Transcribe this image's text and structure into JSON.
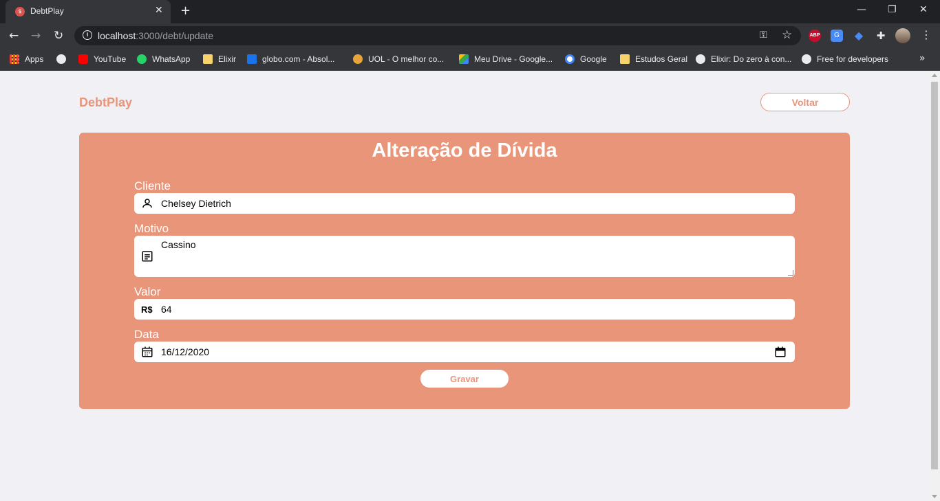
{
  "browser": {
    "tab_title": "DebtPlay",
    "url_host": "localhost",
    "url_rest": ":3000/debt/update",
    "bookmarks": [
      {
        "label": "Apps",
        "icon": "apps-grid-icon",
        "color": "#ea4335"
      },
      {
        "label": "",
        "icon": "globe-icon",
        "color": "#e8eaed"
      },
      {
        "label": "YouTube",
        "icon": "youtube-icon",
        "color": "#ff0000"
      },
      {
        "label": "WhatsApp",
        "icon": "whatsapp-icon",
        "color": "#25d366"
      },
      {
        "label": "Elixir",
        "icon": "folder-icon",
        "color": "#f6d36b"
      },
      {
        "label": "globo.com - Absol...",
        "icon": "globo-icon",
        "color": "#1a73e8"
      },
      {
        "label": "UOL - O melhor co...",
        "icon": "uol-icon",
        "color": "#e8a33a"
      },
      {
        "label": "Meu Drive - Google...",
        "icon": "drive-icon",
        "color": "#34a853"
      },
      {
        "label": "Google",
        "icon": "google-icon",
        "color": "#4285f4"
      },
      {
        "label": "Estudos Geral",
        "icon": "folder-icon",
        "color": "#f6d36b"
      },
      {
        "label": "Elixir: Do zero à con...",
        "icon": "globe-icon",
        "color": "#e8eaed"
      },
      {
        "label": "Free for developers",
        "icon": "globe-icon",
        "color": "#e8eaed"
      }
    ]
  },
  "header": {
    "brand": "DebtPlay",
    "back_label": "Voltar"
  },
  "form": {
    "title": "Alteração de Dívida",
    "client_label": "Cliente",
    "client_value": "Chelsey Dietrich",
    "reason_label": "Motivo",
    "reason_value": "Cassino",
    "amount_label": "Valor",
    "amount_prefix": "R$",
    "amount_value": "64",
    "date_label": "Data",
    "date_value": "16/12/2020",
    "save_label": "Gravar"
  },
  "colors": {
    "accent": "#e8957a",
    "background": "#f0f0f5"
  }
}
